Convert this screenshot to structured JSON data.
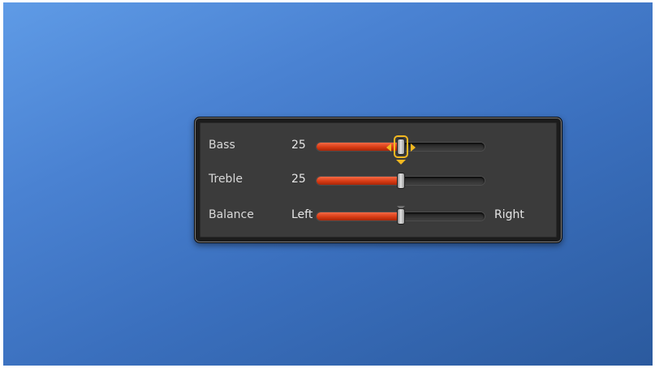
{
  "colors": {
    "accent_fill": "#d83b14",
    "focus": "#f3b820",
    "panel_bg": "#3b3b3b",
    "label_text": "#d9d9d9"
  },
  "sliders": [
    {
      "label": "Bass",
      "value_text": "25",
      "fraction": 0.5,
      "focused": true
    },
    {
      "label": "Treble",
      "value_text": "25",
      "fraction": 0.5,
      "focused": false
    },
    {
      "label": "Balance",
      "min_label": "Left",
      "max_label": "Right",
      "fraction": 0.5,
      "focused": false
    }
  ]
}
